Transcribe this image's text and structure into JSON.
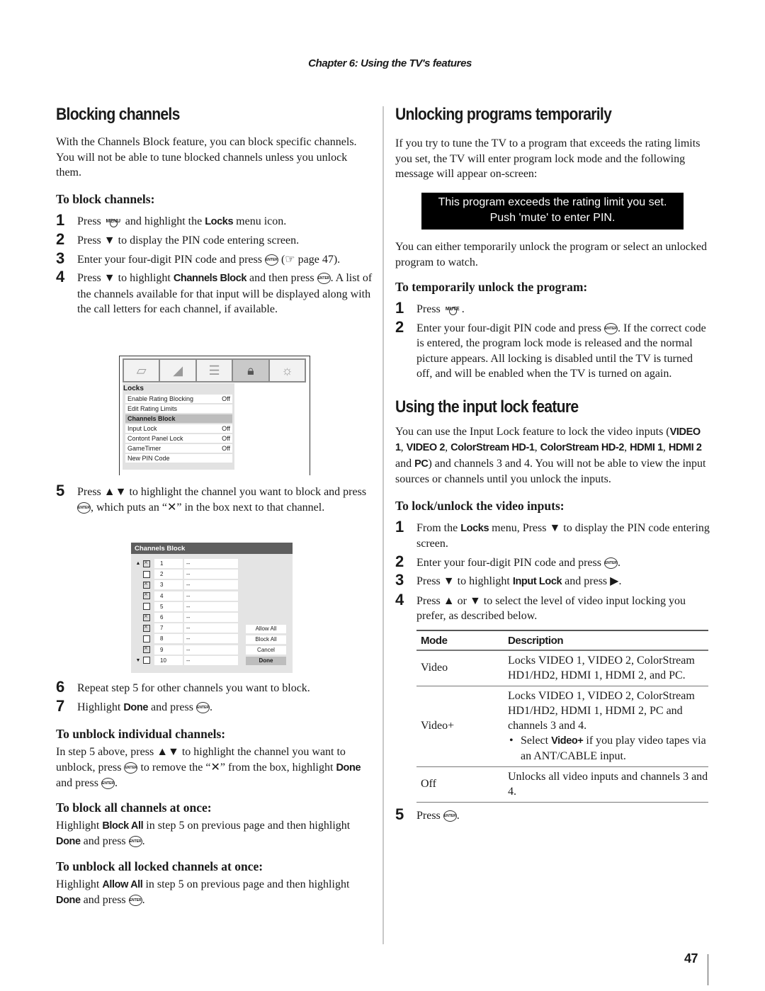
{
  "header": {
    "chapter": "Chapter 6: Using the TV's features"
  },
  "left": {
    "title": "Blocking channels",
    "intro": "With the Channels Block feature, you can block specific channels. You will not be able to tune blocked channels unless you unlock them.",
    "block_heading": "To block channels:",
    "steps": [
      {
        "num": "1",
        "pre": "Press ",
        "button": "MENU",
        "mid": " and highlight the ",
        "bold": "Locks",
        "post": " menu icon."
      },
      {
        "num": "2",
        "text": "Press ▼ to display the PIN code entering screen."
      },
      {
        "num": "3",
        "pre": "Enter your four-digit PIN code and press ",
        "enter": "ENTER",
        "post": " (☞ page 47)."
      },
      {
        "num": "4",
        "pre": "Press ▼ to highlight ",
        "bold": "Channels Block",
        "mid": " and then press ",
        "enter": "ENTER",
        "post": ". A list of the channels available for that input will be displayed along with the call letters for each channel, if available."
      }
    ],
    "locks_menu": {
      "tabs": [
        "picture-tab-icon",
        "audio-tab-icon",
        "preferences-tab-icon",
        "locks-tab-icon",
        "setup-tab-icon"
      ],
      "active_tab": 3,
      "title": "Locks",
      "items": [
        {
          "label": "Enable Rating Blocking",
          "value": "Off"
        },
        {
          "label": "Edit Rating Limits",
          "value": ""
        },
        {
          "label": "Channels Block",
          "value": "",
          "highlighted": true
        },
        {
          "label": "Input Lock",
          "value": "Off"
        },
        {
          "label": "Contont Panel Lock",
          "value": "Off"
        },
        {
          "label": "GameTimer",
          "value": "Off"
        },
        {
          "label": "New PIN Code",
          "value": ""
        }
      ]
    },
    "step5": {
      "num": "5",
      "pre": "Press ▲▼ to highlight the channel you want to block and press ",
      "enter": "ENTER",
      "post": ", which puts an “✕” in the box next to that channel."
    },
    "channels_block": {
      "title": "Channels Block",
      "channels": [
        {
          "num": "1",
          "call": "--",
          "blocked": true
        },
        {
          "num": "2",
          "call": "--",
          "blocked": false
        },
        {
          "num": "3",
          "call": "--",
          "blocked": true
        },
        {
          "num": "4",
          "call": "--",
          "blocked": true
        },
        {
          "num": "5",
          "call": "--",
          "blocked": false
        },
        {
          "num": "6",
          "call": "--",
          "blocked": true
        },
        {
          "num": "7",
          "call": "--",
          "blocked": true
        },
        {
          "num": "8",
          "call": "--",
          "blocked": false
        },
        {
          "num": "9",
          "call": "--",
          "blocked": true
        },
        {
          "num": "10",
          "call": "--",
          "blocked": false
        }
      ],
      "buttons": [
        "Allow All",
        "Block All",
        "Cancel",
        "Done"
      ]
    },
    "step6": {
      "num": "6",
      "text": "Repeat step 5 for other channels you want to block."
    },
    "step7": {
      "num": "7",
      "pre": "Highlight ",
      "bold": "Done",
      "post": " and press ",
      "enter": "ENTER",
      "end": "."
    },
    "unblock_heading": "To unblock individual channels:",
    "unblock_text": {
      "a": "In step 5 above, press ▲▼ to highlight the channel you want to unblock, press ",
      "enter": "ENTER",
      "b": " to remove the “✕” from the box, highlight ",
      "bold": "Done",
      "c": " and press ",
      "d": "."
    },
    "block_all_heading": "To block all channels at once:",
    "block_all_text": {
      "a": "Highlight ",
      "bold1": "Block All",
      "b": " in step 5 on previous page and then highlight ",
      "bold2": "Done",
      "c": " and press ",
      "d": "."
    },
    "unblock_all_heading": "To unblock all locked channels at once:",
    "unblock_all_text": {
      "a": "Highlight ",
      "bold1": "Allow All",
      "b": " in step 5 on previous page and then highlight ",
      "bold2": "Done",
      "c": " and press ",
      "d": "."
    }
  },
  "right": {
    "title": "Unlocking programs temporarily",
    "intro": "If you try to tune the TV to a program that exceeds the rating limits you set, the TV will enter program lock mode and the following message will appear on-screen:",
    "message_line1": "This program exceeds the rating limit you set.",
    "message_line2": "Push 'mute' to enter PIN.",
    "after_message": "You can either temporarily unlock the program or select an unlocked program to watch.",
    "temp_heading": "To temporarily unlock the program:",
    "temp_steps": [
      {
        "num": "1",
        "pre": "Press ",
        "button": "MUTE",
        "post": "."
      },
      {
        "num": "2",
        "pre": "Enter your four-digit PIN code and press ",
        "enter": "ENTER",
        "post": ". If the correct code is entered, the program lock mode is released and the normal picture appears. All locking is disabled until the TV is turned off, and will be enabled when the TV is turned on again."
      }
    ],
    "input_lock_title": "Using the input lock feature",
    "input_lock_intro": {
      "a": "You can use the Input Lock feature to lock the video inputs (",
      "bold1": "VIDEO 1",
      "b": ", ",
      "bold2": "VIDEO 2",
      "c": ", ",
      "bold3": "ColorStream HD-1",
      "d": ", ",
      "bold4": "ColorStream HD-2",
      "e": ", ",
      "bold5": "HDMI 1",
      "f": ", ",
      "bold6": "HDMI 2",
      "g": " and ",
      "bold7": "PC",
      "h": ") and channels 3 and 4. You will not be able to view the input sources or channels until you unlock the inputs."
    },
    "lock_heading": "To lock/unlock the video inputs:",
    "lock_steps": [
      {
        "num": "1",
        "pre": "From the ",
        "bold": "Locks",
        "post": " menu, Press ▼ to display the PIN code entering screen."
      },
      {
        "num": "2",
        "pre": "Enter your four-digit PIN code and press ",
        "enter": "ENTER",
        "post": "."
      },
      {
        "num": "3",
        "pre": "Press ▼ to highlight ",
        "bold": "Input Lock",
        "post": " and press ▶."
      },
      {
        "num": "4",
        "text": "Press ▲ or ▼ to select the level of video input locking you prefer, as described below."
      }
    ],
    "mode_table": {
      "headers": [
        "Mode",
        "Description"
      ],
      "rows": [
        {
          "mode": "Video",
          "desc": "Locks VIDEO 1, VIDEO 2, ColorStream HD1/HD2, HDMI 1, HDMI 2, and PC."
        },
        {
          "mode": "Video+",
          "desc": "Locks VIDEO 1, VIDEO 2, ColorStream HD1/HD2, HDMI 1, HDMI 2, PC and channels 3 and 4.",
          "bullet_pre": "Select ",
          "bullet_bold": "Video+",
          "bullet_post": " if you play video tapes via an ANT/CABLE input."
        },
        {
          "mode": "Off",
          "desc": "Unlocks all video inputs and channels 3 and 4."
        }
      ]
    },
    "step5": {
      "num": "5",
      "pre": "Press ",
      "enter": "ENTER",
      "post": "."
    }
  },
  "footer": {
    "page_number": "47"
  }
}
